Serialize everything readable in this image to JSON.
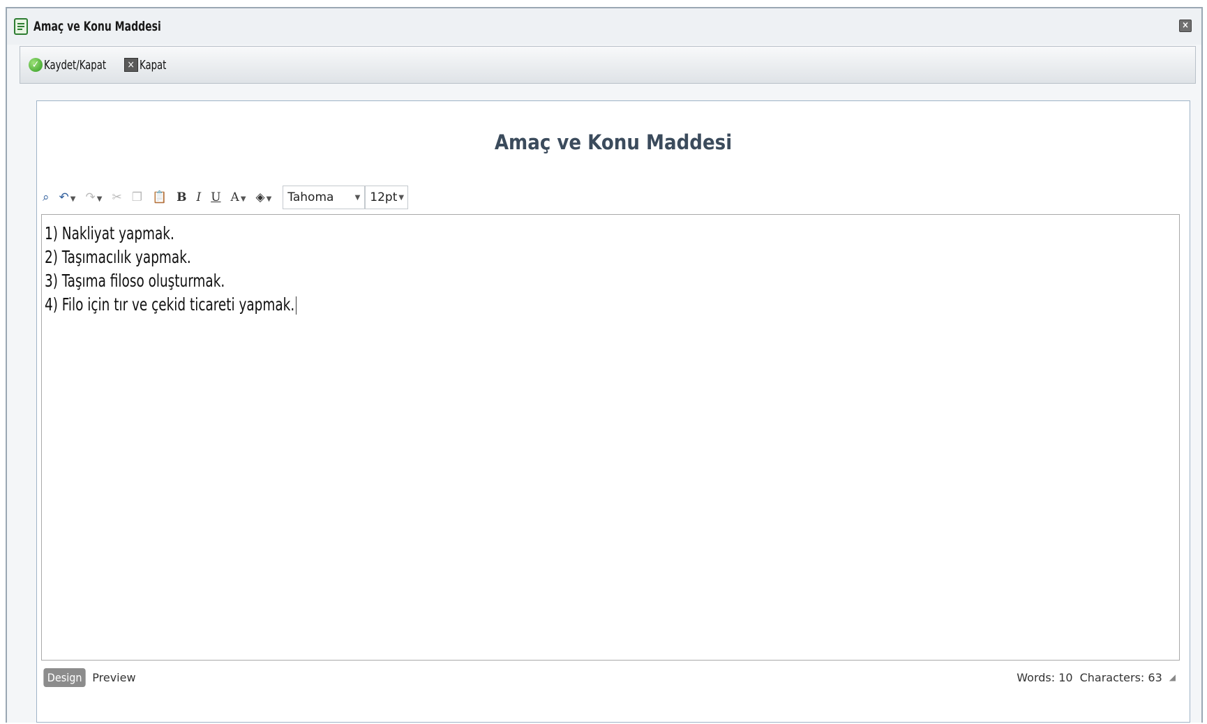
{
  "window": {
    "title": "Amaç ve Konu Maddesi",
    "close_icon": "close-icon"
  },
  "toolbar": {
    "save_close_label": "Kaydet/Kapat",
    "close_label": "Kapat"
  },
  "document": {
    "heading": "Amaç ve Konu Maddesi"
  },
  "editor_toolbar": {
    "font_family": "Tahoma",
    "font_size": "12pt",
    "icons": [
      "find-icon",
      "undo-icon",
      "redo-icon",
      "cut-icon",
      "copy-icon",
      "paste-icon",
      "bold-icon",
      "italic-icon",
      "underline-icon",
      "font-color-icon",
      "highlight-icon"
    ]
  },
  "editor": {
    "lines": [
      "1) Nakliyat yapmak.",
      "2) Taşımacılık yapmak.",
      "3) Taşıma filoso oluşturmak.",
      "4) Filo için tır ve çekid ticareti yapmak."
    ]
  },
  "footer": {
    "design_tab": "Design",
    "preview_tab": "Preview",
    "words": "Words: 10",
    "characters": "Characters: 63"
  }
}
